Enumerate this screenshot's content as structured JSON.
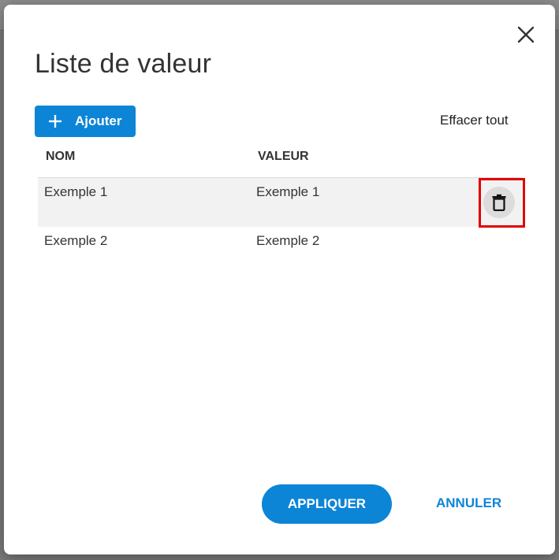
{
  "dialog": {
    "title": "Liste de valeur",
    "add_label": "Ajouter",
    "clear_all_label": "Effacer tout",
    "close_icon": "close-icon",
    "columns": {
      "name": "NOM",
      "value": "VALEUR"
    },
    "rows": [
      {
        "name": "Exemple 1",
        "value": "Exemple 1"
      },
      {
        "name": "Exemple 2",
        "value": "Exemple 2"
      }
    ],
    "delete_icon": "trash-icon",
    "apply_label": "APPLIQUER",
    "cancel_label": "ANNULER"
  },
  "colors": {
    "accent": "#0c85d7",
    "highlight": "#e00000",
    "row_hover": "#f2f2f2"
  }
}
